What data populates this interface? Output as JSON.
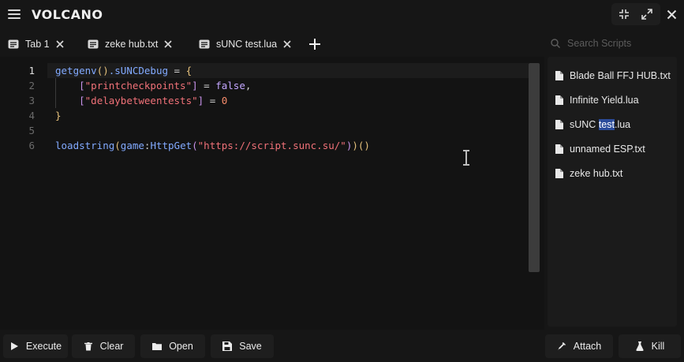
{
  "app": {
    "title": "VOLCANO"
  },
  "window_controls": {
    "icons": [
      "shrink-icon",
      "expand-icon",
      "close-icon"
    ]
  },
  "tabs": [
    {
      "label": "Tab 1"
    },
    {
      "label": "zeke hub.txt"
    },
    {
      "label": "sUNC test.lua"
    }
  ],
  "editor": {
    "line_numbers": [
      "1",
      "2",
      "3",
      "4",
      "5",
      "6"
    ],
    "lines": [
      [
        "getgenv",
        "()",
        ".sUNCDebug",
        " = ",
        "{"
      ],
      [
        "    ",
        "[",
        "\"printcheckpoints\"",
        "]",
        " = ",
        "false",
        ","
      ],
      [
        "    ",
        "[",
        "\"delaybetweentests\"",
        "]",
        " = ",
        "0"
      ],
      [
        "}"
      ],
      [],
      [
        "loadstring",
        "(",
        "game",
        ":",
        "HttpGet",
        "(",
        "\"https://script.sunc.su/\"",
        ")",
        ")",
        "()"
      ]
    ]
  },
  "sidebar": {
    "search_placeholder": "Search Scripts",
    "scripts": [
      {
        "label": "Blade Ball FFJ HUB.txt"
      },
      {
        "label": "Infinite Yield.lua"
      },
      {
        "pre": "sUNC ",
        "highlight": "test",
        "post": ".lua"
      },
      {
        "label": "unnamed ESP.txt"
      },
      {
        "label": "zeke hub.txt"
      }
    ]
  },
  "actions": {
    "execute": "Execute",
    "clear": "Clear",
    "open": "Open",
    "save": "Save",
    "attach": "Attach",
    "kill": "Kill"
  },
  "colors": {
    "background": "#161616",
    "selection": "#2b4c9b",
    "function": "#82aaff",
    "string": "#f07178",
    "keyword": "#c3a6ff",
    "number": "#f78c6c",
    "brace": "#e5c07b"
  }
}
